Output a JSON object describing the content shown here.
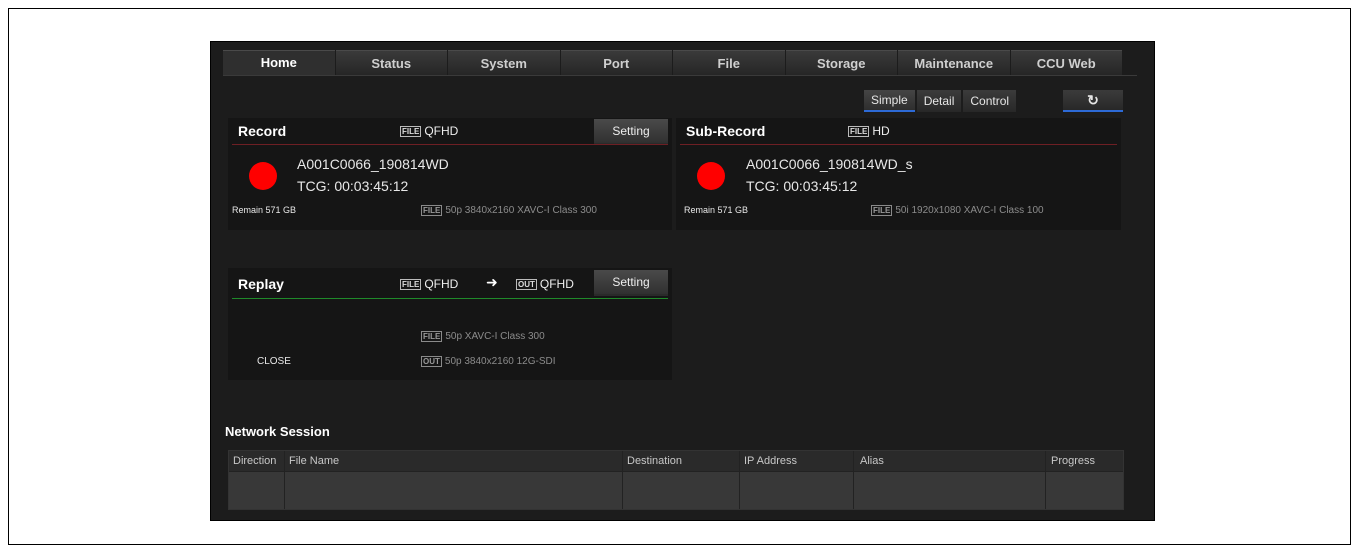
{
  "tabs": [
    {
      "label": "Home"
    },
    {
      "label": "Status"
    },
    {
      "label": "System"
    },
    {
      "label": "Port"
    },
    {
      "label": "File"
    },
    {
      "label": "Storage"
    },
    {
      "label": "Maintenance"
    },
    {
      "label": "CCU Web"
    }
  ],
  "view_buttons": {
    "simple": "Simple",
    "detail": "Detail",
    "control": "Control"
  },
  "refresh_icon": "refresh-icon",
  "record": {
    "title": "Record",
    "badge": "FILE",
    "format": "QFHD",
    "setting": "Setting",
    "clip": "A001C0066_190814WD",
    "tcg": "TCG: 00:03:45:12",
    "remain": "Remain 571 GB",
    "info_badge": "FILE",
    "info": "50p 3840x2160 XAVC-I Class 300",
    "divider_color": "#6e1f24"
  },
  "sub_record": {
    "title": "Sub-Record",
    "badge": "FILE",
    "format": "HD",
    "clip": "A001C0066_190814WD_s",
    "tcg": "TCG: 00:03:45:12",
    "remain": "Remain 571 GB",
    "info_badge": "FILE",
    "info": "50i 1920x1080 XAVC-I Class 100",
    "divider_color": "#6e1f24"
  },
  "replay": {
    "title": "Replay",
    "in_badge": "FILE",
    "in_format": "QFHD",
    "arrow": "➜",
    "out_badge": "OUT",
    "out_format": "QFHD",
    "setting": "Setting",
    "file_badge": "FILE",
    "file_info": "50p XAVC-I Class 300",
    "out_info_badge": "OUT",
    "out_info": "50p 3840x2160 12G-SDI",
    "status": "CLOSE",
    "divider_color": "#1f8a2a"
  },
  "network_session": {
    "title": "Network Session",
    "columns": [
      "Direction",
      "File Name",
      "Destination",
      "IP Address",
      "Alias",
      "Progress"
    ]
  },
  "colors": {
    "record_dot": "#ff0000",
    "accent_blue": "#2d6ad6"
  }
}
